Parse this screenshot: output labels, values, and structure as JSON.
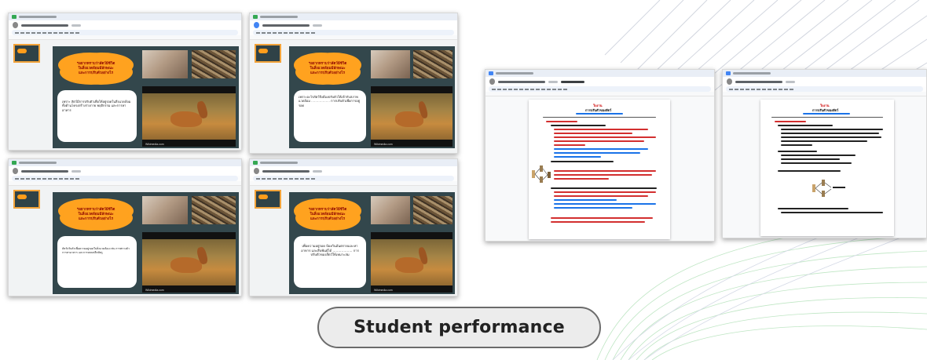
{
  "footer": {
    "label": "Student performance"
  },
  "slides": {
    "cloud_text": "ฯอยากทราบว่าสัตว์มีชีวิต\nในสิ่งแวดล้อมมีลักษณะ\nและการปรับตัวอย่างไร",
    "caption": "Wikimedia.com",
    "answers": [
      "เพราะ สัตว์มีการปรับตัวเพื่อให้อยู่รอดในสิ่งแวดล้อม ทั้งด้านโครงสร้างร่างกาย พฤติกรรม และการหาอาหาร",
      "เพราะอะไรสัตว์จึงต้องปรับตัวให้เข้ากับสภาพแวดล้อม ……………… การปรับตัวเพื่อการอยู่รอด",
      "สัตว์ปรับตัวเพื่อความอยู่รอดในสิ่งแวดล้อม เช่น การพรางตัว การหาอาหาร และการหลบหลีกศัตรู",
      "เพื่อความอยู่รอด ป้องกันอันตรายและหาอาหาร และสืบพันธุ์ได้ ……………… การปรับตัวของสัตว์ให้เหมาะสม"
    ]
  },
  "documents": {
    "heading": "ใบงาน",
    "subheading": "การปรับตัวของสัตว์"
  }
}
